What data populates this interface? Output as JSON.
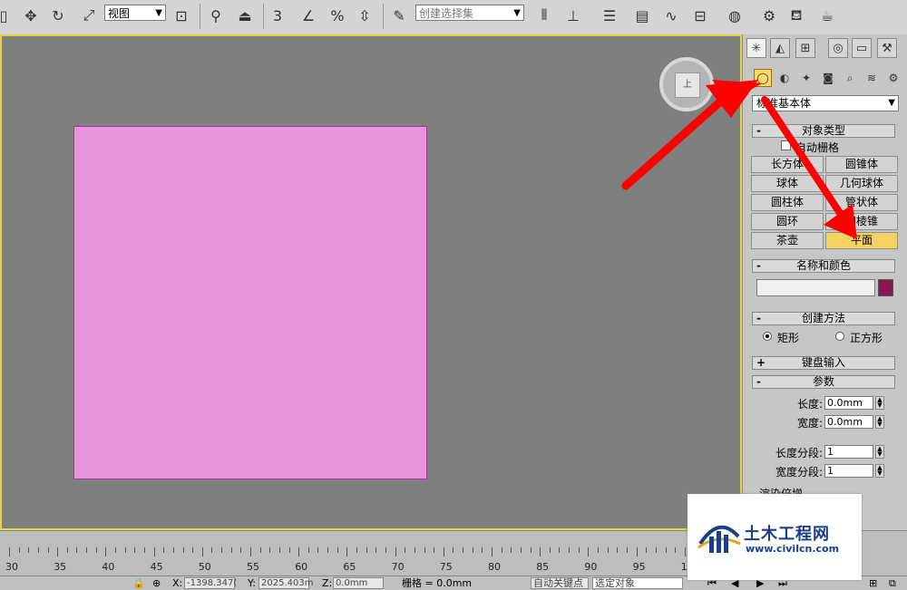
{
  "toolbar": {
    "view_dropdown": "视图",
    "selection_set_placeholder": "创建选择集",
    "snap_label": "3"
  },
  "viewport": {
    "viewcube_label": "上"
  },
  "command_panel": {
    "category_dropdown": "标准基本体",
    "object_type": {
      "title": "对象类型",
      "autogrid_label": "自动栅格",
      "buttons": [
        "长方体",
        "圆锥体",
        "球体",
        "几何球体",
        "圆柱体",
        "管状体",
        "圆环",
        "四棱锥",
        "茶壶",
        "平面"
      ],
      "active_button": "平面"
    },
    "name_color": {
      "title": "名称和颜色",
      "name_value": "",
      "color": "#8b1a4a"
    },
    "creation_method": {
      "title": "创建方法",
      "options": [
        "矩形",
        "正方形"
      ],
      "selected": "矩形"
    },
    "keyboard_entry": {
      "title": "键盘输入"
    },
    "parameters": {
      "title": "参数",
      "length_label": "长度:",
      "length_value": "0.0mm",
      "width_label": "宽度:",
      "width_value": "0.0mm",
      "length_segs_label": "长度分段:",
      "length_segs_value": "1",
      "width_segs_label": "宽度分段:",
      "width_segs_value": "1",
      "render_multipliers": "渲染倍增"
    }
  },
  "timeline": {
    "ticks": [
      "30",
      "35",
      "40",
      "45",
      "50",
      "55",
      "60",
      "65",
      "70",
      "75",
      "80",
      "85",
      "90",
      "95",
      "100"
    ]
  },
  "statusbar": {
    "x_label": "X:",
    "x_value": "-1398.347(",
    "y_label": "Y:",
    "y_value": "2025.403m",
    "z_label": "Z:",
    "z_value": "0.0mm",
    "grid_text": "栅格 = 0.0mm",
    "auto_key": "自动关键点",
    "selected_object": "选定对象"
  },
  "watermark": {
    "title": "土木工程网",
    "url": "www.civilcn.com"
  },
  "colors": {
    "plane": "#e994dc",
    "viewport_bg": "#7f7f7f",
    "viewport_border": "#e6d23c",
    "active_button": "#f6d263",
    "arrow": "#ff0000"
  }
}
